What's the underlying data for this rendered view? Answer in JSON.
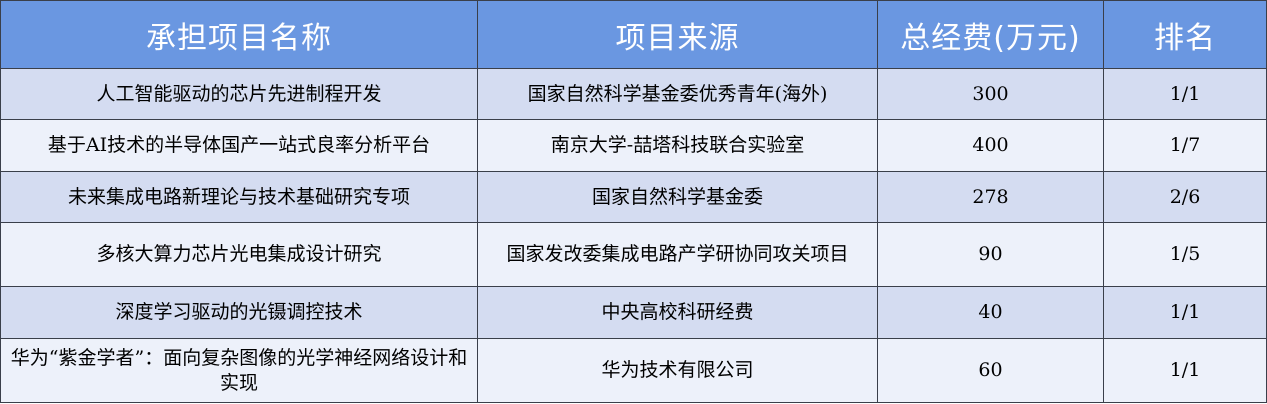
{
  "colors": {
    "header_bg": "#6a97e1",
    "row_odd_bg": "#d4dcf1",
    "row_even_bg": "#edf1fa",
    "border": "#3a3f4a",
    "header_text": "#ffffff"
  },
  "table": {
    "headers": [
      "承担项目名称",
      "项目来源",
      "总经费(万元)",
      "排名"
    ],
    "rows": [
      [
        "人工智能驱动的芯片先进制程开发",
        "国家自然科学基金委优秀青年(海外)",
        "300",
        "1/1"
      ],
      [
        "基于AI技术的半导体国产一站式良率分析平台",
        "南京大学-喆塔科技联合实验室",
        "400",
        "1/7"
      ],
      [
        "未来集成电路新理论与技术基础研究专项",
        "国家自然科学基金委",
        "278",
        "2/6"
      ],
      [
        "多核大算力芯片光电集成设计研究",
        "国家发改委集成电路产学研协同攻关项目",
        "90",
        "1/5"
      ],
      [
        "深度学习驱动的光镊调控技术",
        "中央高校科研经费",
        "40",
        "1/1"
      ],
      [
        "华为“紫金学者”：面向复杂图像的光学神经网络设计和实现",
        "华为技术有限公司",
        "60",
        "1/1"
      ]
    ]
  }
}
